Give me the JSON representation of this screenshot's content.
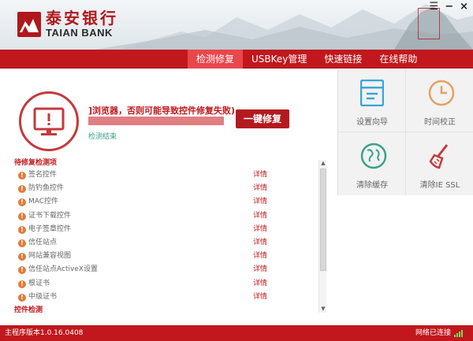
{
  "brand": {
    "name_cn": "泰安银行",
    "name_en": "TAIAN BANK",
    "color": "#c0181d"
  },
  "window_controls": {
    "menu": "☰",
    "minimize": "−",
    "close": "×"
  },
  "nav": {
    "tabs": [
      "检测修复",
      "USBKey管理",
      "快速链接",
      "在线帮助"
    ],
    "active": 0
  },
  "status": {
    "message": "]浏览器，否则可能导致控件修复失败)",
    "progress": 1.0,
    "repair_button": "一键修复",
    "check_result": "检测结束"
  },
  "tools": [
    {
      "label": "设置向导",
      "icon": "setup-wizard-icon"
    },
    {
      "label": "时间校正",
      "icon": "clock-icon"
    },
    {
      "label": "清除缓存",
      "icon": "globe-icon"
    },
    {
      "label": "清除IE SSL",
      "icon": "broom-icon"
    }
  ],
  "list": {
    "section_title": "待修复检测项",
    "detail_label": "详情",
    "items": [
      "签名控件",
      "防钓鱼控件",
      "MAC控件",
      "证书下载控件",
      "电子签章控件",
      "信任站点",
      "网站兼容视图",
      "信任站点ActiveX设置",
      "根证书",
      "中级证书"
    ],
    "section_2_title": "控件检测"
  },
  "footer": {
    "version": "主程序版本1.0.16.0408",
    "network": "网络已连接"
  }
}
